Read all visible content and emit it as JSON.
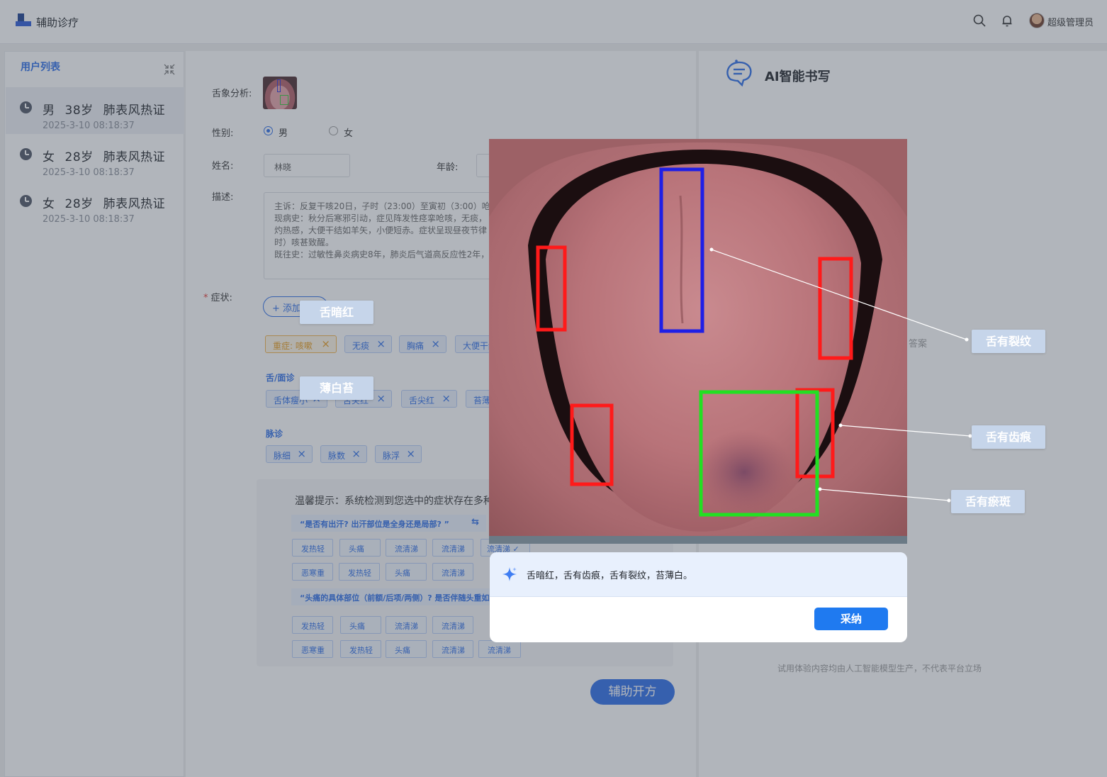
{
  "header": {
    "app_title": "辅助诊疗",
    "search_icon": "search-icon",
    "bell_icon": "bell-icon",
    "username": "超级管理员"
  },
  "sidebar": {
    "title": "用户列表",
    "patients": [
      {
        "gender": "男",
        "age": "38岁",
        "diagnosis": "肺表风热证",
        "time": "2025-3-10 08:18:37",
        "active": true
      },
      {
        "gender": "女",
        "age": "28岁",
        "diagnosis": "肺表风热证",
        "time": "2025-3-10 08:18:37",
        "active": false
      },
      {
        "gender": "女",
        "age": "28岁",
        "diagnosis": "肺表风热证",
        "time": "2025-3-10 08:18:37",
        "active": false
      }
    ]
  },
  "form": {
    "tongue_label": "舌象分析:",
    "gender_label": "性别:",
    "gender_options": [
      "男",
      "女"
    ],
    "gender_selected": "男",
    "name_label": "姓名:",
    "name_value": "林晓",
    "age_label": "年龄:",
    "desc_label": "描述:",
    "desc_lines": [
      "主诉：反复干咳20日，子时（23:00）至寅初（3:00）呛咳",
      "现病史：秋分后寒邪引动，症见阵发性痉挛呛咳，无痰，",
      "灼热感，大便干结如羊矢，小便短赤。症状呈现昼夜节律",
      "时）咳甚致醒。",
      "既往史：过敏性鼻炎病史8年，肺炎后气道高反应性2年，"
    ],
    "symptom_label": "症状:",
    "add_symptom_label": "+ 添加症状",
    "symptom_tags": [
      "重症: 咳嗽",
      "无痰",
      "胸痛",
      "大便干结"
    ],
    "tongue_section_title": "舌/面诊",
    "tongue_tags": [
      "舌体瘦小",
      "舌尖红",
      "舌尖红",
      "苔薄白"
    ],
    "pulse_section_title": "脉诊",
    "pulse_tags": [
      "脉细",
      "脉数",
      "脉浮"
    ],
    "tip_title": "温馨提示：系统检测到您选中的症状存在多种可能",
    "question_1": "“是否有出汗? 出汗部位是全身还是局部? ”",
    "question_2": "“头痛的具体部位（前额/后项/两侧）? 是否伴随头重如裹? ”",
    "chips_row_1": [
      "发热轻",
      "头痛",
      "流清涕",
      "流清涕",
      "流清涕 ✓"
    ],
    "chips_row_2": [
      "恶寒重",
      "发热轻",
      "头痛",
      "流清涕"
    ],
    "chips_row_3": [
      "发热轻",
      "头痛",
      "流清涕",
      "流清涕"
    ],
    "chips_row_4": [
      "恶寒重",
      "发热轻",
      "头痛",
      "流清涕",
      "流清涕"
    ],
    "submit_label": "辅助开方"
  },
  "ai_panel": {
    "title": "AI智能书写",
    "partial_text": "答案",
    "disclaimer": "试用体验内容均由人工智能模型生产，不代表平台立场"
  },
  "analysis": {
    "labels": {
      "dark_red": "舌暗红",
      "thin_white": "薄白苔",
      "cracks": "舌有裂纹",
      "teeth_marks": "舌有齿痕",
      "stasis": "舌有瘀斑"
    },
    "box_colors": {
      "crack": "#1f1fe6",
      "teeth": "#ff1a1a",
      "stasis": "#22e022"
    },
    "result_text": "舌暗红，舌有齿痕，舌有裂纹，苔薄白。",
    "adopt_label": "采纳"
  }
}
